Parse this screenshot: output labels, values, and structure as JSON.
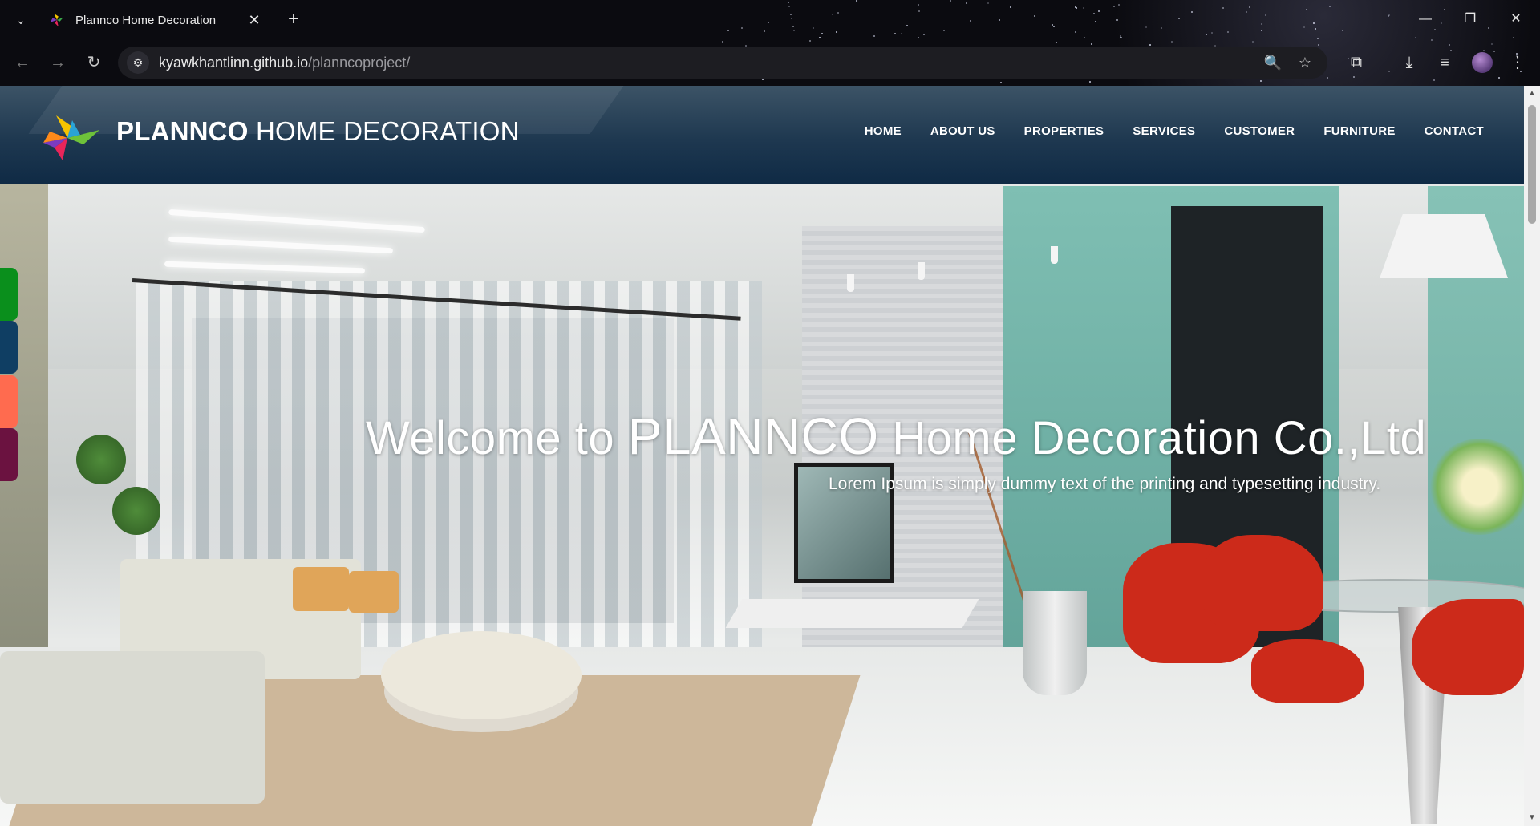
{
  "browser": {
    "tab": {
      "title": "Plannco Home Decoration",
      "favicon": "plannco-pinwheel-icon",
      "close_glyph": "✕"
    },
    "new_tab_glyph": "+",
    "tab_list_glyph": "⌄",
    "window_controls": {
      "minimize": "—",
      "restore": "❐",
      "close": "✕"
    },
    "nav": {
      "back": "←",
      "forward": "→",
      "reload": "↻"
    },
    "address": {
      "host": "kyawkhantlinn.github.io",
      "path": "/planncoproject/",
      "site_info_glyph": "⚙"
    },
    "toolbar_icons": {
      "zoom": "🔍",
      "bookmark": "☆",
      "extensions": "⧉",
      "downloads": "⤓",
      "media": "≡",
      "menu": "⋮"
    }
  },
  "site": {
    "brand": {
      "strong": "PLANNCO",
      "rest": " HOME DECORATION"
    },
    "nav": [
      "HOME",
      "ABOUT US",
      "PROPERTIES",
      "SERVICES",
      "CUSTOMER",
      "FURNITURE",
      "CONTACT"
    ],
    "hero": {
      "title_start": "Welcome to ",
      "title_brand": "PLANNCO",
      "title_end": " Home Decoration Co.,Ltd",
      "subtitle": "Lorem Ipsum is simply dummy text of the printing and typesetting industry."
    },
    "color_swatches": [
      "#0a8f1c",
      "#0f3e63",
      "#ff6b4f",
      "#6b1240"
    ],
    "colors": {
      "header_top": "#3c5366",
      "header_bottom": "#0f2a45",
      "text": "#ffffff"
    }
  },
  "scrollbar": {
    "up": "▲",
    "down": "▼",
    "position": 0.0
  }
}
